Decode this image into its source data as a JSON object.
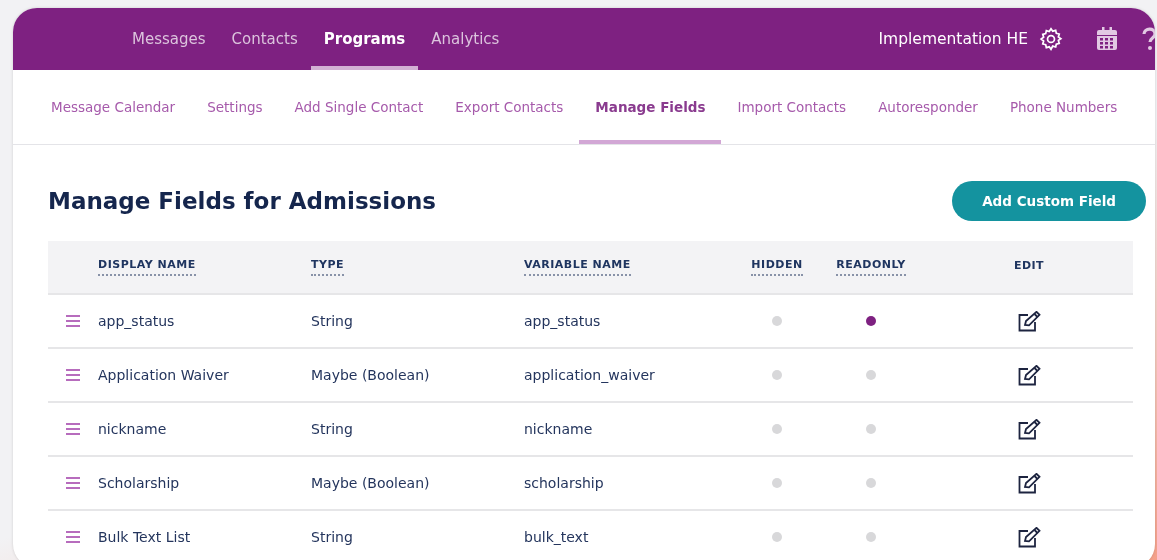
{
  "top_nav": {
    "items": [
      {
        "label": "Messages",
        "selected": false
      },
      {
        "label": "Contacts",
        "selected": false
      },
      {
        "label": "Programs",
        "selected": true
      },
      {
        "label": "Analytics",
        "selected": false
      }
    ],
    "account": "Implementation HE"
  },
  "tabs": [
    {
      "label": "Message Calendar",
      "selected": false
    },
    {
      "label": "Settings",
      "selected": false
    },
    {
      "label": "Add Single Contact",
      "selected": false
    },
    {
      "label": "Export Contacts",
      "selected": false
    },
    {
      "label": "Manage Fields",
      "selected": true
    },
    {
      "label": "Import Contacts",
      "selected": false
    },
    {
      "label": "Autoresponder",
      "selected": false
    },
    {
      "label": "Phone Numbers",
      "selected": false
    }
  ],
  "heading": "Manage Fields for Admissions",
  "add_button": "Add Custom Field",
  "table": {
    "columns": [
      {
        "label": "DISPLAY NAME",
        "sortable": true
      },
      {
        "label": "TYPE",
        "sortable": true
      },
      {
        "label": "VARIABLE NAME",
        "sortable": true
      },
      {
        "label": "HIDDEN",
        "sortable": true
      },
      {
        "label": "READONLY",
        "sortable": true
      },
      {
        "label": "EDIT",
        "sortable": false
      }
    ],
    "rows": [
      {
        "display_name": "app_status",
        "type": "String",
        "variable_name": "app_status",
        "hidden": false,
        "readonly": true
      },
      {
        "display_name": "Application Waiver",
        "type": "Maybe (Boolean)",
        "variable_name": "application_waiver",
        "hidden": false,
        "readonly": false
      },
      {
        "display_name": "nickname",
        "type": "String",
        "variable_name": "nickname",
        "hidden": false,
        "readonly": false
      },
      {
        "display_name": "Scholarship",
        "type": "Maybe (Boolean)",
        "variable_name": "scholarship",
        "hidden": false,
        "readonly": false
      },
      {
        "display_name": "Bulk Text List",
        "type": "String",
        "variable_name": "bulk_text",
        "hidden": false,
        "readonly": false
      }
    ]
  }
}
